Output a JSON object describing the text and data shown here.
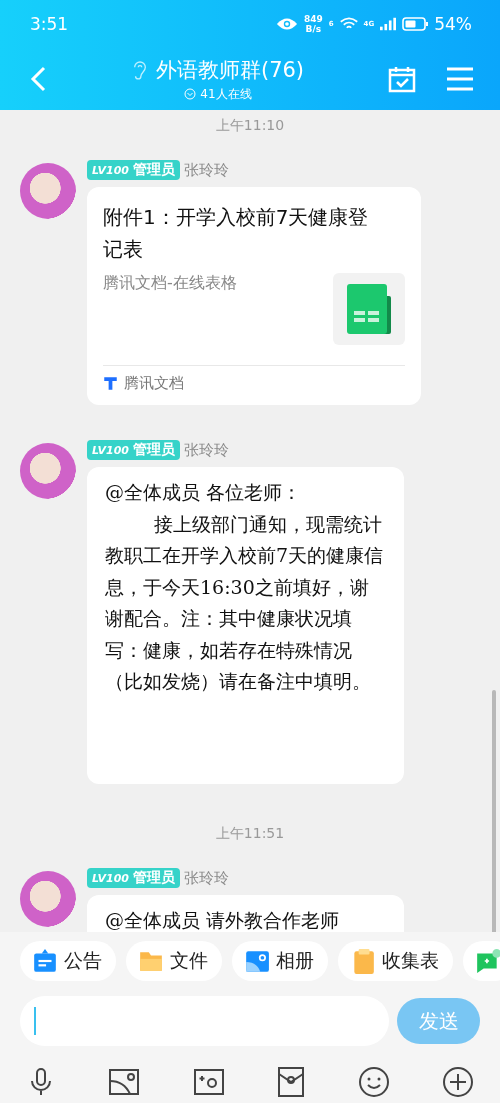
{
  "status_bar": {
    "time": "3:51",
    "net_speed_value": "849",
    "net_speed_unit": "B/s",
    "wifi_label": "6",
    "cell_label": "4G",
    "battery": "54%"
  },
  "header": {
    "title": "外语教师群(76)",
    "online": "41人在线"
  },
  "messages": [
    {
      "kind": "doc",
      "time": "上午11:10",
      "level": "LV100",
      "role": "管理员",
      "sender": "张玲玲",
      "title": "附件1：开学入校前7天健康登记表",
      "subtitle": "腾讯文档-在线表格",
      "source": "腾讯文档"
    },
    {
      "kind": "text",
      "level": "LV100",
      "role": "管理员",
      "sender": "张玲玲",
      "paragraphs": [
        "@全体成员 各位老师：",
        "接上级部门通知，现需统计教职工在开学入校前7天的健康信息，于今天16:30之前填好，谢谢配合。注：其中健康状况填写：健康，如若存在特殊情况（比如发烧）请在备注中填明。"
      ]
    },
    {
      "kind": "text",
      "time": "上午11:51",
      "level": "LV100",
      "role": "管理员",
      "sender": "张玲玲",
      "paragraphs": [
        "@全体成员 请外教合作老师"
      ]
    }
  ],
  "quick_actions": [
    {
      "kind": "notice",
      "label": "公告"
    },
    {
      "kind": "file",
      "label": "文件"
    },
    {
      "kind": "album",
      "label": "相册"
    },
    {
      "kind": "form",
      "label": "收集表"
    },
    {
      "kind": "essence"
    }
  ],
  "composer": {
    "send": "发送",
    "send_disabled": true
  }
}
